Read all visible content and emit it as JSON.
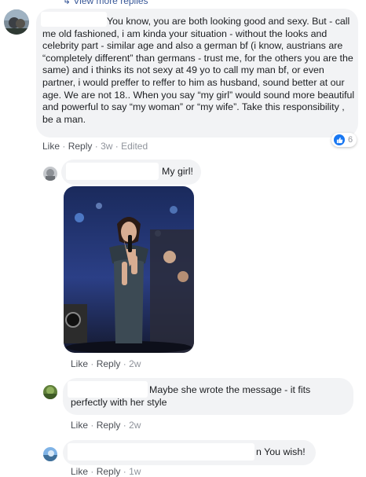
{
  "top_link": "View more replies",
  "comment1": {
    "text": "You know, you are both looking good and sexy. But - call me old fashioned, i am kinda your situation - without the looks and celebrity part - similar age and also a german bf (i know, austrians are “completely different” than germans - trust me, for the others you are the same) and i thinks its not sexy at 49 yo to call my man bf, or even partner, i would preffer to reffer to him as husband, sound better at our age. We are not 18.. When you say “my girl” would sound more beautiful and powerful to say “my woman” or “my wife”. Take this responsibility , be a man.",
    "like": "Like",
    "reply": "Reply",
    "time": "3w",
    "edited": "Edited",
    "reaction_count": "6"
  },
  "reply1": {
    "text": "My girl!",
    "like": "Like",
    "reply": "Reply",
    "time": "2w"
  },
  "reply2": {
    "text": "Maybe she wrote the message - it fits perfectly with her style",
    "like": "Like",
    "reply": "Reply",
    "time": "2w"
  },
  "reply3": {
    "text": "n You wish!",
    "like": "Like",
    "reply": "Reply",
    "time": "1w"
  },
  "colors": {
    "bubble": "#f2f3f5",
    "like_blue": "#1877f2",
    "meta": "#4b4f56"
  }
}
